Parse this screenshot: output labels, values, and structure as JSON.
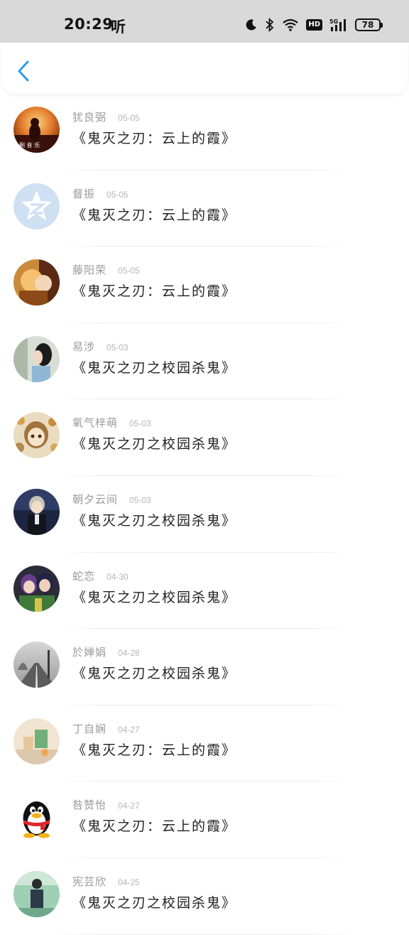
{
  "status_bar": {
    "time": "20:29",
    "app_char": "听",
    "battery": "78",
    "hd_label": "HD",
    "icons": [
      "moon-icon",
      "bluetooth-icon",
      "wifi-icon",
      "hd-icon",
      "5g-signal-icon",
      "battery-icon"
    ]
  },
  "header": {
    "back_icon": "chevron-left-icon",
    "accent": "#2e9be6"
  },
  "items": [
    {
      "username": "犹良弼",
      "date": "05-05",
      "title": "《鬼灭之刃：云上的霞》",
      "avatar": "sunset-girl"
    },
    {
      "username": "督振",
      "date": "05-05",
      "title": "《鬼灭之刃：云上的霞》",
      "avatar": "qzone-logo"
    },
    {
      "username": "藤阳荣",
      "date": "05-05",
      "title": "《鬼灭之刃：云上的霞》",
      "avatar": "anime-couple"
    },
    {
      "username": "易涉",
      "date": "05-03",
      "title": "《鬼灭之刃之校园杀鬼》",
      "avatar": "girl-profile"
    },
    {
      "username": "氧气梓萌",
      "date": "05-03",
      "title": "《鬼灭之刃之校园杀鬼》",
      "avatar": "anime-girl-flowers"
    },
    {
      "username": "朝夕云间",
      "date": "05-03",
      "title": "《鬼灭之刃之校园杀鬼》",
      "avatar": "anime-boy-night"
    },
    {
      "username": "蛇恋",
      "date": "04-30",
      "title": "《鬼灭之刃之校园杀鬼》",
      "avatar": "anime-duo"
    },
    {
      "username": "於婵娟",
      "date": "04-28",
      "title": "《鬼灭之刃之校园杀鬼》",
      "avatar": "foggy-road"
    },
    {
      "username": "丁自娴",
      "date": "04-27",
      "title": "《鬼灭之刃：云上的霞》",
      "avatar": "still-life"
    },
    {
      "username": "咎赞怡",
      "date": "04-27",
      "title": "《鬼灭之刃：云上的霞》",
      "avatar": "qq-penguin"
    },
    {
      "username": "宪芸欣",
      "date": "04-25",
      "title": "《鬼灭之刃之校园杀鬼》",
      "avatar": "person-outdoor"
    }
  ]
}
